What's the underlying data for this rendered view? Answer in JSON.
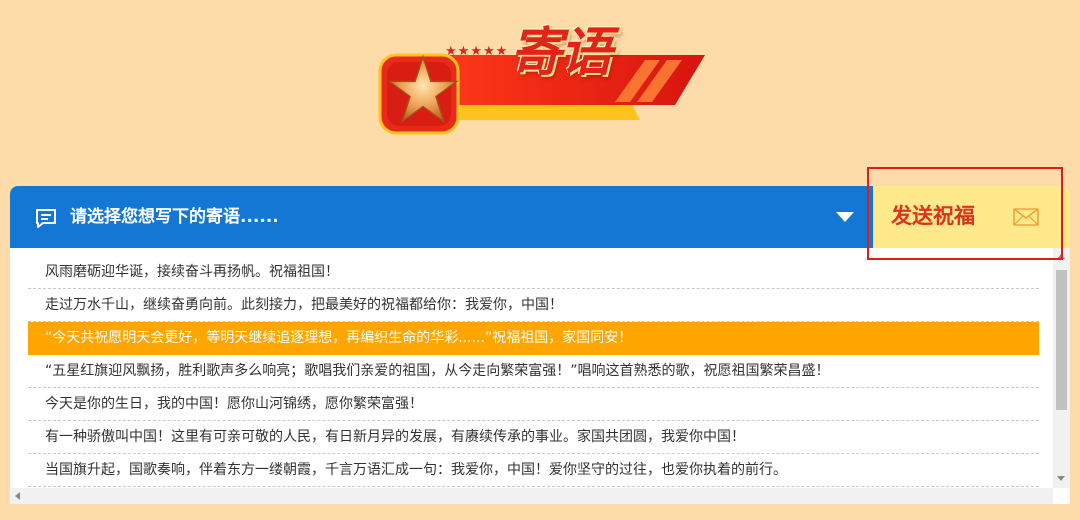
{
  "header": {
    "title": "寄语",
    "stars": "★★★★★"
  },
  "selector": {
    "placeholder": "请选择您想写下的寄语......"
  },
  "send_button": {
    "label": "发送祝福"
  },
  "messages": [
    "风雨磨砺迎华诞，接续奋斗再扬帆。祝福祖国！",
    "走过万水千山，继续奋勇向前。此刻接力，把最美好的祝福都给你：我爱你，中国！",
    "“今天共祝愿明天会更好，等明天继续追逐理想，再编织生命的华彩......”祝福祖国，家国同安！",
    "“五星红旗迎风飘扬，胜利歌声多么响亮；歌唱我们亲爱的祖国，从今走向繁荣富强！”唱响这首熟悉的歌，祝愿祖国繁荣昌盛！",
    "今天是你的生日，我的中国！愿你山河锦绣，愿你繁荣富强！",
    "有一种骄傲叫中国！这里有可亲可敬的人民，有日新月异的发展，有赓续传承的事业。家国共团圆，我爱你中国！",
    "当国旗升起，国歌奏响，伴着东方一缕朝霞，千言万语汇成一句：我爱你，中国！爱你坚守的过往，也爱你执着的前行。"
  ],
  "selected_index": 2,
  "colors": {
    "background": "#fddcaa",
    "bar_blue": "#1577d4",
    "send_bg": "#ffe98a",
    "send_text": "#d9341f",
    "selected_row": "#ffa600",
    "highlight_border": "#e41b1b"
  },
  "icons": {
    "chat": "chat-bubble-icon",
    "caret": "caret-down-icon",
    "mail": "envelope-icon",
    "star": "star-emblem-icon"
  }
}
